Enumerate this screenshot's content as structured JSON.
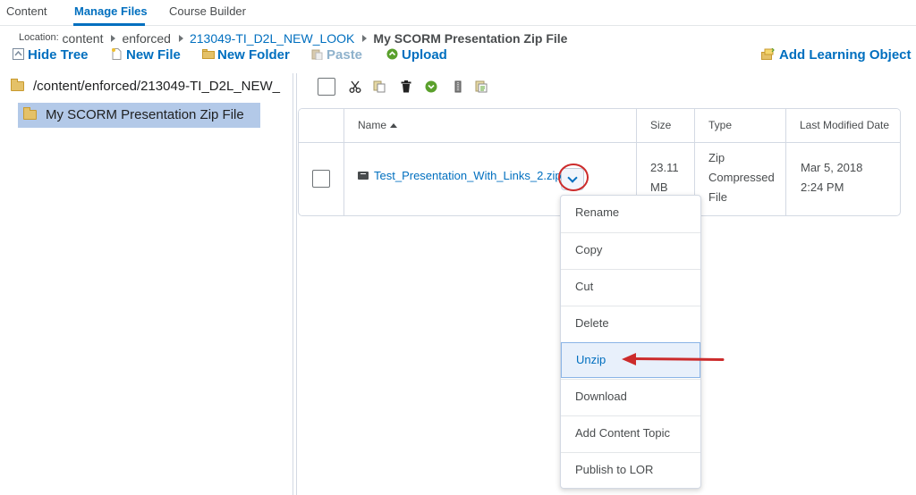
{
  "tabs": [
    {
      "label": "Content"
    },
    {
      "label": "Manage Files",
      "active": true
    },
    {
      "label": "Course Builder"
    }
  ],
  "location": {
    "label": "Location:",
    "crumbs": [
      "content",
      "enforced",
      "213049-TI_D2L_NEW_LOOK",
      "My SCORM Presentation Zip File"
    ]
  },
  "actions": {
    "hide_tree": "Hide Tree",
    "new_file": "New File",
    "new_folder": "New Folder",
    "paste": "Paste",
    "upload": "Upload",
    "add_learning_object": "Add Learning Object"
  },
  "tree": {
    "root": "/content/enforced/213049-TI_D2L_NEW_",
    "selected": "My SCORM Presentation Zip File"
  },
  "toolbar_icons": [
    "select-all-checkbox",
    "cut-icon",
    "copy-icon",
    "delete-icon",
    "download-icon",
    "zip-icon",
    "properties-icon"
  ],
  "table": {
    "columns": [
      "Name",
      "Size",
      "Type",
      "Last Modified Date"
    ],
    "rows": [
      {
        "name": "Test_Presentation_With_Links_2.zip",
        "size_line1": "23.11",
        "size_line2": "MB",
        "type_line1": "Zip",
        "type_line2": "Compressed",
        "type_line3": "File",
        "date_line1": "Mar 5, 2018",
        "date_line2": "2:24 PM"
      }
    ]
  },
  "context_menu": {
    "items": [
      "Rename",
      "Copy",
      "Cut",
      "Delete",
      "Unzip",
      "Download",
      "Add Content Topic",
      "Publish to LOR"
    ],
    "highlighted": "Unzip"
  },
  "colors": {
    "link": "#006fbf",
    "highlight_annotation": "#cc2b2b",
    "tree_selected": "#b3c9e8"
  }
}
